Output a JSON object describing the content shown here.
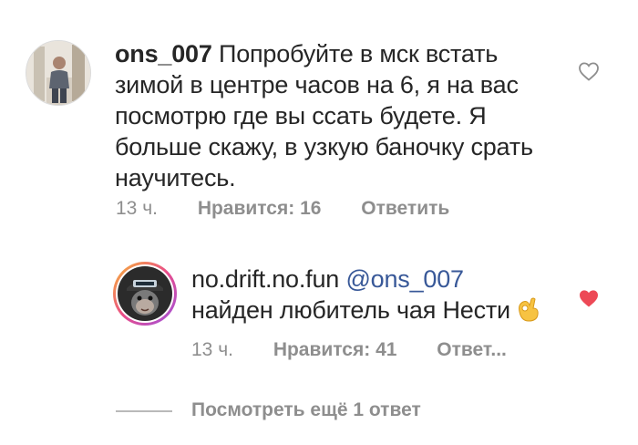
{
  "comment1": {
    "username": "ons_007",
    "text": "Попробуйте в мск встать зимой в центре часов на 6, я на вас посмотрю где вы ссать будете. Я больше скажу, в узкую баночку срать научитесь.",
    "time": "13 ч.",
    "likes": "Нравится: 16",
    "reply": "Ответить",
    "liked": false
  },
  "comment2": {
    "username": "no.drift.no.fun",
    "mention": "@ons_007",
    "text": "найден любитель чая Нести",
    "emoji": "ok-hand-emoji",
    "time": "13 ч.",
    "likes": "Нравится: 41",
    "reply": "Ответ...",
    "liked": true
  },
  "view_more": "Посмотреть ещё 1 ответ",
  "colors": {
    "liked_heart": "#ed4956",
    "meta_gray": "#8e8e8e",
    "mention": "#385898"
  },
  "icons": {
    "heart_outline": "heart-outline-icon",
    "heart_filled": "heart-filled-icon"
  }
}
